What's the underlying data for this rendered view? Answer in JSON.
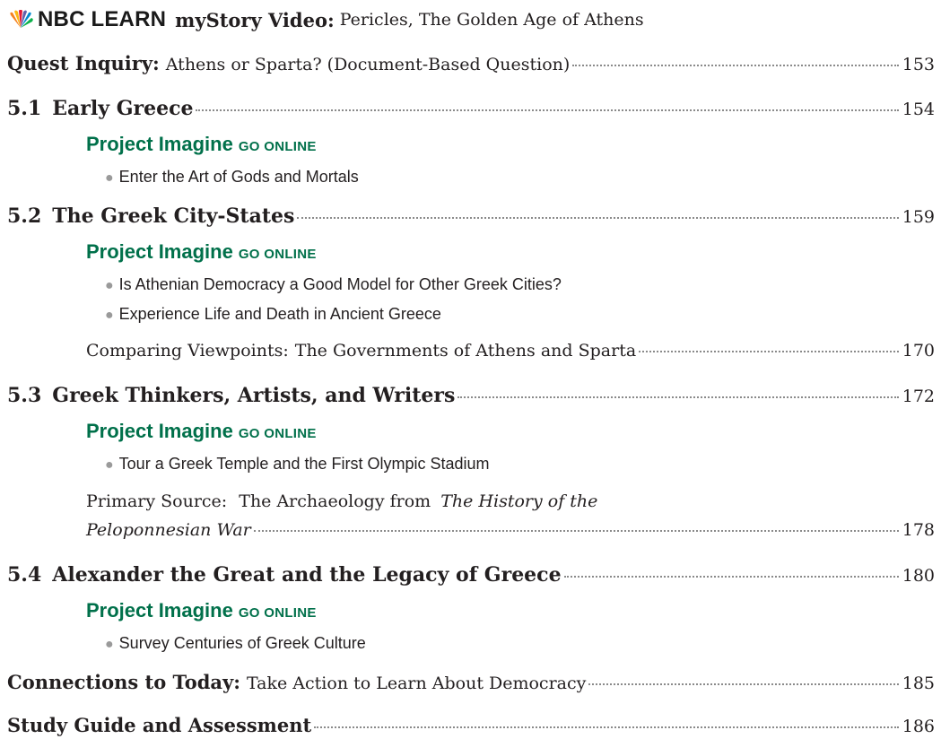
{
  "header": {
    "logo_text": "NBC LEARN",
    "mystory_label": "myStory Video:",
    "mystory_title": "Pericles, The Golden Age of Athens"
  },
  "quest": {
    "label": "Quest Inquiry:",
    "text": "Athens or Sparta? (Document-Based Question)",
    "page": "153"
  },
  "lessons": [
    {
      "number": "5.1",
      "title": "Early Greece",
      "page": "154",
      "project_label": "Project Imagine",
      "project_online": "GO ONLINE",
      "bullets": [
        "Enter the Art of Gods and Mortals"
      ]
    },
    {
      "number": "5.2",
      "title": "The Greek City-States",
      "page": "159",
      "project_label": "Project Imagine",
      "project_online": "GO ONLINE",
      "bullets": [
        "Is Athenian Democracy a Good Model for Other Greek Cities?",
        "Experience Life and Death in Ancient Greece"
      ],
      "feature_label": "Comparing Viewpoints:",
      "feature_text": "The Governments of Athens and Sparta",
      "feature_page": "170"
    },
    {
      "number": "5.3",
      "title": "Greek Thinkers, Artists, and Writers",
      "page": "172",
      "project_label": "Project Imagine",
      "project_online": "GO ONLINE",
      "bullets": [
        "Tour a Greek Temple and the First Olympic Stadium"
      ],
      "feature_label": "Primary Source:",
      "feature_text": "The Archaeology from",
      "feature_italic_1": "The History of the",
      "feature_italic_2": "Peloponnesian War",
      "feature_page": "178"
    },
    {
      "number": "5.4",
      "title": "Alexander the Great and the Legacy of Greece",
      "page": "180",
      "project_label": "Project Imagine",
      "project_online": "GO ONLINE",
      "bullets": [
        "Survey Centuries of Greek Culture"
      ]
    }
  ],
  "connections": {
    "label": "Connections to Today:",
    "text": "Take Action to Learn About Democracy",
    "page": "185"
  },
  "study": {
    "label": "Study Guide and Assessment",
    "page": "186"
  },
  "colors": {
    "accent_green": "#00704a",
    "text": "#231f20",
    "leader_dots": "#8a8a8a"
  },
  "icons": {
    "logo": "nbc-peacock-icon",
    "bullet": "bullet-dot-icon"
  }
}
